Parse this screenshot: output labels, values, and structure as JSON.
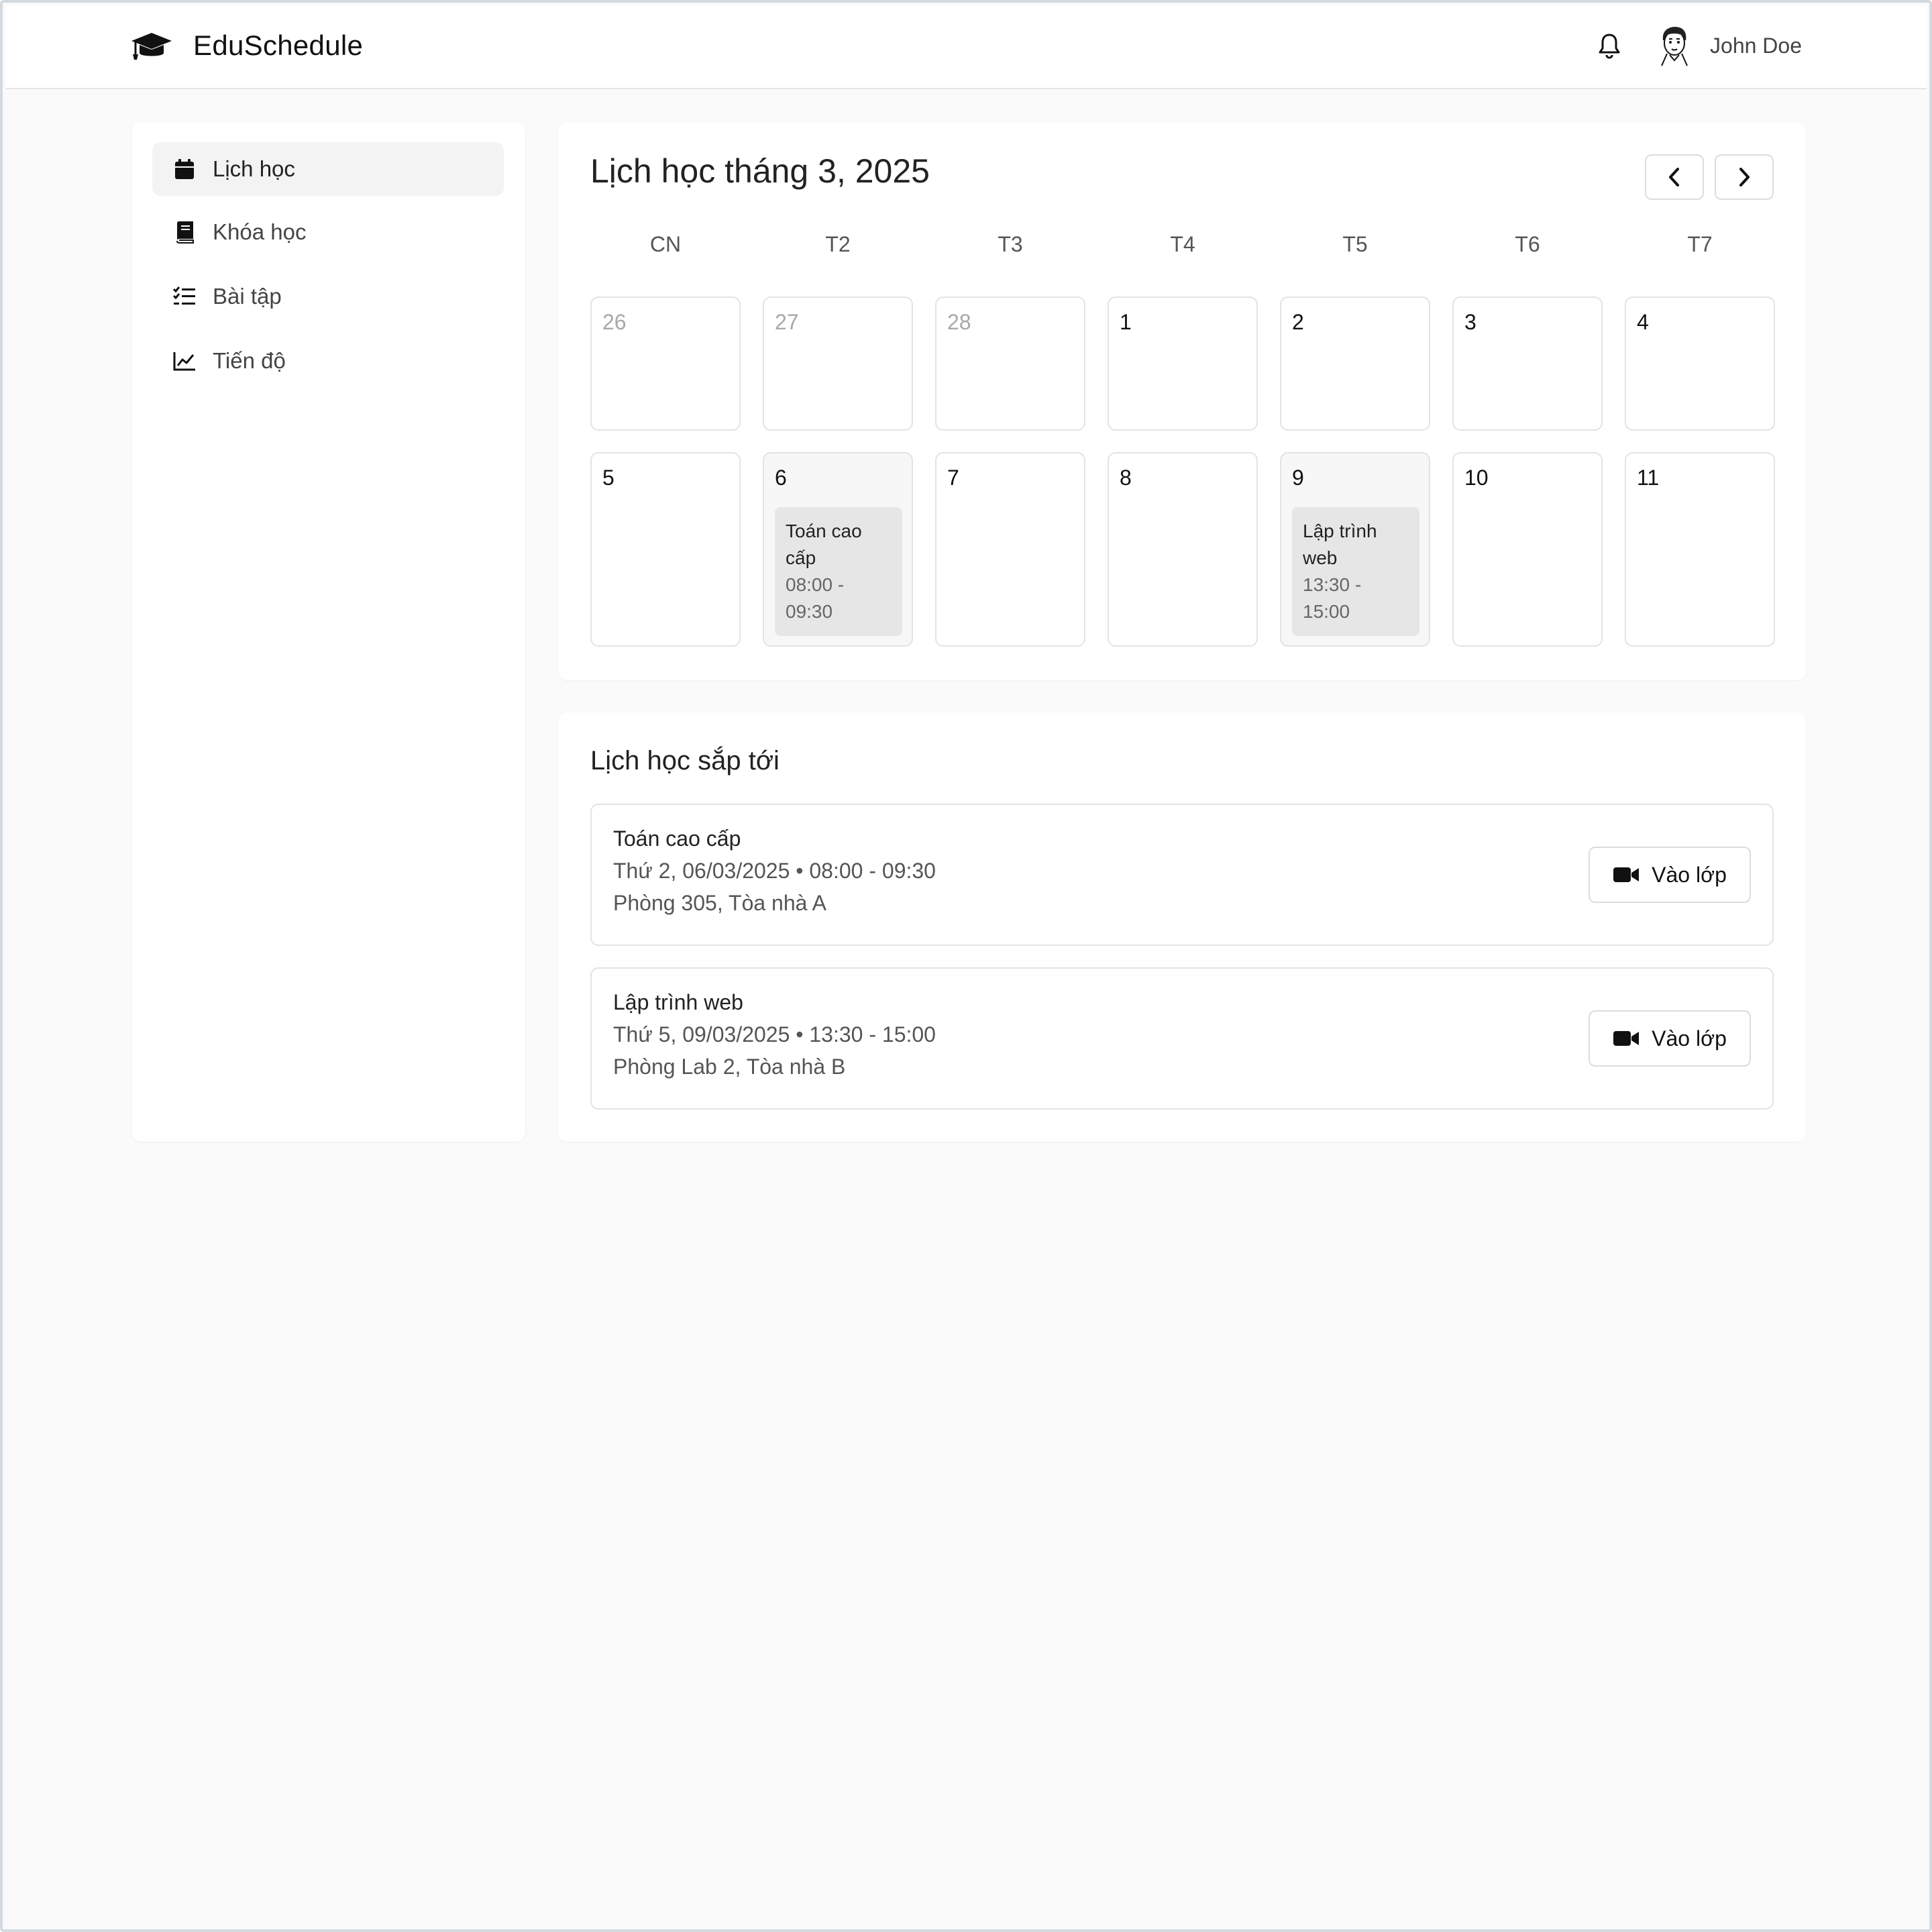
{
  "app": {
    "name": "EduSchedule",
    "logo_icon": "graduation-cap-icon"
  },
  "header": {
    "user_name": "John Doe",
    "notification_icon": "bell-icon"
  },
  "sidebar": {
    "items": [
      {
        "label": "Lịch học",
        "icon": "calendar-icon",
        "active": true
      },
      {
        "label": "Khóa học",
        "icon": "book-icon",
        "active": false
      },
      {
        "label": "Bài tập",
        "icon": "checklist-icon",
        "active": false
      },
      {
        "label": "Tiến độ",
        "icon": "chart-line-icon",
        "active": false
      }
    ]
  },
  "calendar": {
    "title": "Lịch học tháng 3, 2025",
    "prev_icon": "chevron-left-icon",
    "next_icon": "chevron-right-icon",
    "weekdays": [
      "CN",
      "T2",
      "T3",
      "T4",
      "T5",
      "T6",
      "T7"
    ],
    "weeks": [
      [
        {
          "day": "26",
          "muted": true
        },
        {
          "day": "27",
          "muted": true
        },
        {
          "day": "28",
          "muted": true
        },
        {
          "day": "1",
          "muted": false
        },
        {
          "day": "2",
          "muted": false
        },
        {
          "day": "3",
          "muted": false
        },
        {
          "day": "4",
          "muted": false
        }
      ],
      [
        {
          "day": "5",
          "muted": false
        },
        {
          "day": "6",
          "muted": false,
          "event": {
            "title": "Toán cao cấp",
            "time": "08:00 - 09:30"
          }
        },
        {
          "day": "7",
          "muted": false
        },
        {
          "day": "8",
          "muted": false
        },
        {
          "day": "9",
          "muted": false,
          "event": {
            "title": "Lập trình web",
            "time": "13:30 - 15:00"
          }
        },
        {
          "day": "10",
          "muted": false
        },
        {
          "day": "11",
          "muted": false
        }
      ]
    ]
  },
  "upcoming": {
    "title": "Lịch học sắp tới",
    "items": [
      {
        "course": "Toán cao cấp",
        "datetime": "Thứ 2, 06/03/2025 • 08:00 - 09:30",
        "location": "Phòng 305, Tòa nhà A",
        "button_label": "Vào lớp",
        "button_icon": "video-camera-icon"
      },
      {
        "course": "Lập trình web",
        "datetime": "Thứ 5, 09/03/2025 • 13:30 - 15:00",
        "location": "Phòng Lab 2, Tòa nhà B",
        "button_label": "Vào lớp",
        "button_icon": "video-camera-icon"
      }
    ]
  }
}
